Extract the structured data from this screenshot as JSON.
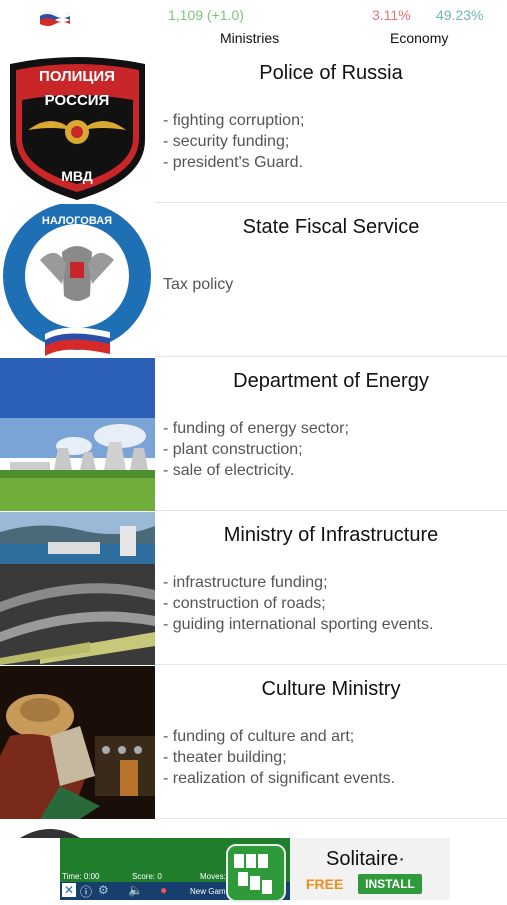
{
  "header": {
    "ministries_value": "1,109 (+1.0)",
    "ministries_label": "Ministries",
    "economy_change": "3.11%",
    "economy_value": "49.23%",
    "economy_label": "Economy",
    "flag_icon": "russia-flag-icon",
    "colors": {
      "green": "#7cc47a",
      "red": "#e0787a",
      "teal": "#6fb7b3"
    }
  },
  "ministries": [
    {
      "title": "Police of Russia",
      "image": "police-emblem-icon",
      "lines": [
        "- fighting corruption;",
        "- security funding;",
        "- president's Guard."
      ]
    },
    {
      "title": "State Fiscal Service",
      "image": "tax-service-emblem-icon",
      "lines": [
        "Tax policy"
      ]
    },
    {
      "title": "Department of Energy",
      "image": "power-plant-image",
      "lines": [
        "- funding of energy sector;",
        "- plant construction;",
        "- sale of electricity."
      ]
    },
    {
      "title": "Ministry of Infrastructure",
      "image": "infrastructure-image",
      "lines": [
        "- infrastructure funding;",
        "- construction of roads;",
        "- guiding international sporting events."
      ]
    },
    {
      "title": "Culture Ministry",
      "image": "culture-image",
      "lines": [
        "- funding of culture and art;",
        "- theater building;",
        "- realization of significant events."
      ]
    }
  ],
  "ad": {
    "title": "Solitaire·",
    "free": "FREE",
    "install": "INSTALL",
    "game_time": "Time: 0:00",
    "game_score": "Score: 0",
    "game_moves": "Moves:",
    "game_new": "New Game"
  }
}
